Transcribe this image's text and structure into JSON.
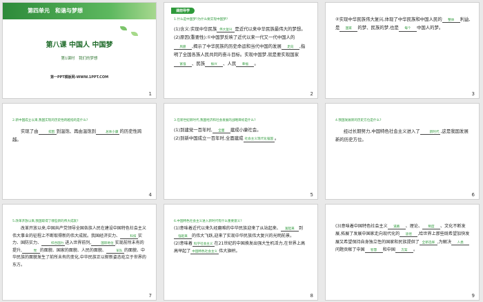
{
  "slides": [
    {
      "unit": "第四单元　和谐与梦想",
      "title": "第八课 中国人 中国梦",
      "subtitle": "第1课时　我们的梦想",
      "site": "第一PPT模板网-WWW.1PPT.COM",
      "num": "1"
    },
    {
      "tag": "课前导学",
      "q": "1.什么是中国梦?为什么要实现中国梦?",
      "p1": "(1)含义:实现中华民族",
      "a1": "伟大复兴",
      "p1b": "是近代以来中华民族最伟大的梦想。",
      "p2": "(2)原因(重要性):①中国梦反映了近代以来一代又一代中国人的",
      "a2": "夙愿",
      "p2b": ",揭示了中华民族的历史命运和当代中国的发展",
      "a3": "走向",
      "p2c": ",指明了全国各族人民共同的奋斗目标。实现中国梦,就是要实现国家",
      "a4": "富强",
      "p2d": "、民族",
      "a5": "振兴",
      "p2e": "、人民",
      "a6": "幸福",
      "p2f": "。",
      "num": "2"
    },
    {
      "p1": "②实现中华民族伟大复兴,体现了中华民族和中国人民的",
      "a1": "整体",
      "p1b": "利益,是",
      "a2": "国家",
      "p1c": "的梦、民族的梦,也是",
      "a3": "每个",
      "p1d": "中国人的梦。",
      "num": "3"
    },
    {
      "q": "2.新中国成立以来,我国实现的历史性跨越指的是什么?",
      "p1": "实现了由",
      "a1": "贫困",
      "p1b": "到温饱、再由温饱到",
      "a2": "总体小康",
      "p1c": "的历史性跨越。",
      "num": "4"
    },
    {
      "q": "3.在新世纪新时代,我国经济和社会发展的战略目标是什么?",
      "p1": "(1)到建党一百年时,",
      "a1": "全面",
      "p1b": "建成小康社会。",
      "p2": "(2)到新中国成立一百年时,全面建成",
      "a2": "社会主义现代化强国",
      "p2b": "。",
      "num": "5"
    },
    {
      "q": "4.我国发展新的历史方位是什么?",
      "p1": "经过长期努力,中国特色社会主义进入了",
      "a1": "新时代",
      "p1b": ",这是我国发展新的历史方位。",
      "num": "6"
    },
    {
      "q": "5.改革开放以来,我国取得了哪些新的伟大成就?",
      "p1": "改革开放以来,中国共产党领导全国各族人民在建设中国特色社会主义伟大事业的征程上不断取得新的伟大成就。我国经济实力、",
      "a1": "科技",
      "p1b": "实力、国防实力、",
      "a2": "综合国力",
      "p1c": "进入世界前列,",
      "a3": "国际地位",
      "p1d": "实现前所未有的提升,",
      "a4": "党",
      "p1e": "的面貌、国家的面貌、人民的面貌、",
      "a5": "军队",
      "p1f": "的面貌、中华民族的面貌发生了前所未有的变化,中华民族正以崭新姿态屹立于世界的东方。",
      "num": "7"
    },
    {
      "q": "6.中国特色社会主义进入新时代有什么重要意义?",
      "p1": "(1)意味着近代以来久经磨难的中华民族迎来了从站起来、",
      "a1": "富起来",
      "p1b": "到",
      "a2": "强起来",
      "p1c": "的伟大飞跃,迎来了实现中华民族伟大复兴的光明前景。",
      "p2": "(2)意味着",
      "a3": "科学社会主义",
      "p2b": "在21世纪的中国焕发出强大生机活力,在世界上高高举起了",
      "a4": "中国特色社会主义",
      "p2c": "伟大旗帜。",
      "num": "8"
    },
    {
      "p1": "(3)意味着中国特色社会主义",
      "a1": "道路",
      "p1b": "、理论、",
      "a2": "制度",
      "p1c": "、文化不断发展,拓展了发展中国家走向现代化的",
      "a3": "途径",
      "p1d": ",给世界上那些既希望加快发展又希望保持自身独立性的国家和民族提供了",
      "a4": "全新选择",
      "p1e": ",为解决",
      "a5": "人类",
      "p1f": "问题贡献了中国",
      "a6": "智慧",
      "p1g": "和中国",
      "a7": "方案",
      "p1h": "。",
      "num": "9"
    }
  ]
}
